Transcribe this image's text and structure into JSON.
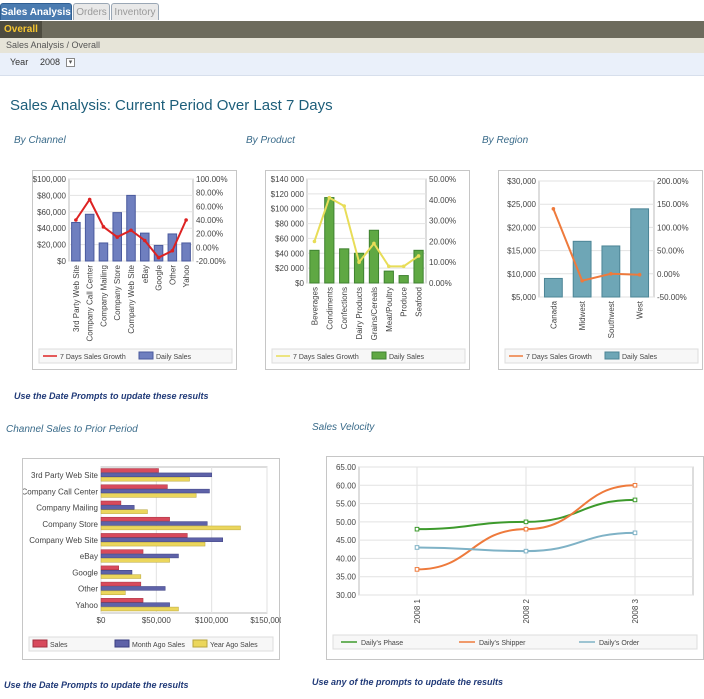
{
  "tabs": [
    {
      "label": "Sales Analysis",
      "active": true
    },
    {
      "label": "Orders",
      "active": false
    },
    {
      "label": "Inventory",
      "active": false
    }
  ],
  "subtab": "Overall",
  "breadcrumb": "Sales Analysis / Overall",
  "prompt": {
    "label": "Year",
    "value": "2008"
  },
  "page_title": "Sales Analysis: Current Period Over Last 7 Days",
  "sections": {
    "by_channel": "By Channel",
    "by_product": "By Product",
    "by_region": "By Region",
    "prior_period": "Channel Sales to Prior Period",
    "velocity": "Sales Velocity"
  },
  "notes": {
    "top": "Use the Date Prompts to update these results",
    "bottom_left": "Use the Date Prompts to update the results",
    "bottom_right": "Use any of the prompts to update the results"
  },
  "colors": {
    "accent": "#4a7bb0",
    "bar_blue": "#6f7fbf",
    "bar_green": "#5fa843",
    "bar_teal": "#6ea6b6",
    "line_red": "#dd2222",
    "line_yellow": "#e8dd58",
    "line_orange": "#ee7a3c",
    "hbar_red": "#d84a5c",
    "hbar_blue": "#5e62a8",
    "hbar_yellow": "#ebd65c"
  },
  "chart_data": [
    {
      "type": "bar",
      "id": "by_channel",
      "categories": [
        "3rd Party Web Site",
        "Company Call Center",
        "Company Mailing",
        "Company Store",
        "Company Web Site",
        "eBay",
        "Google",
        "Other",
        "Yahoo"
      ],
      "series": [
        {
          "name": "Daily Sales",
          "kind": "bar",
          "axis": "left",
          "values": [
            47000,
            57000,
            22000,
            59000,
            80000,
            34000,
            19000,
            33000,
            22000
          ]
        },
        {
          "name": "7 Days Sales Growth",
          "kind": "line",
          "axis": "right",
          "values": [
            40,
            70,
            30,
            15,
            25,
            10,
            -15,
            -5,
            40
          ]
        }
      ],
      "ylim": [
        0,
        100000
      ],
      "y2lim": [
        -20,
        100
      ],
      "yticks": [
        "$0",
        "$20,000",
        "$40,000",
        "$60,000",
        "$80,000",
        "$100,000"
      ],
      "y2ticks": [
        "-20.00%",
        "0.00%",
        "20.00%",
        "40.00%",
        "60.00%",
        "80.00%",
        "100.00%"
      ]
    },
    {
      "type": "bar",
      "id": "by_product",
      "categories": [
        "Beverages",
        "Condiments",
        "Confections",
        "Dairy Products",
        "Grains/Cereals",
        "Meat/Poultry",
        "Produce",
        "Seafood"
      ],
      "series": [
        {
          "name": "Daily Sales",
          "kind": "bar",
          "axis": "left",
          "values": [
            44000,
            115000,
            46000,
            40000,
            71000,
            16000,
            10000,
            44000
          ]
        },
        {
          "name": "7 Days Sales Growth",
          "kind": "line",
          "axis": "right",
          "values": [
            20,
            41,
            37,
            10,
            19,
            8,
            8,
            13
          ]
        }
      ],
      "ylim": [
        0,
        140000
      ],
      "y2lim": [
        0,
        50
      ],
      "yticks": [
        "$0",
        "$20 000",
        "$40 000",
        "$60 000",
        "$80 000",
        "$100 000",
        "$120 000",
        "$140 000"
      ],
      "y2ticks": [
        "0.00%",
        "10.00%",
        "20.00%",
        "30.00%",
        "40.00%",
        "50.00%"
      ]
    },
    {
      "type": "bar",
      "id": "by_region",
      "categories": [
        "Canada",
        "Midwest",
        "Southwest",
        "West"
      ],
      "series": [
        {
          "name": "Daily Sales",
          "kind": "bar",
          "axis": "left",
          "values": [
            9000,
            17000,
            16000,
            24000
          ]
        },
        {
          "name": "7 Days Sales Growth",
          "kind": "line",
          "axis": "right",
          "values": [
            140,
            -15,
            0,
            -2
          ]
        }
      ],
      "ylim": [
        5000,
        30000
      ],
      "y2lim": [
        -50,
        200
      ],
      "yticks": [
        "$5,000",
        "$10,000",
        "$15,000",
        "$20,000",
        "$25,000",
        "$30,000"
      ],
      "y2ticks": [
        "-50.00%",
        "0.00%",
        "50.00%",
        "100.00%",
        "150.00%",
        "200.00%"
      ]
    },
    {
      "type": "bar",
      "id": "prior_period",
      "orientation": "horizontal",
      "categories": [
        "3rd Party Web Site",
        "Company Call Center",
        "Company Mailing",
        "Company Store",
        "Company Web Site",
        "eBay",
        "Google",
        "Other",
        "Yahoo"
      ],
      "series": [
        {
          "name": "Sales",
          "values": [
            52000,
            60000,
            18000,
            62000,
            78000,
            38000,
            16000,
            36000,
            38000
          ]
        },
        {
          "name": "Month Ago Sales",
          "values": [
            100000,
            98000,
            30000,
            96000,
            110000,
            70000,
            28000,
            58000,
            62000
          ]
        },
        {
          "name": "Year Ago Sales",
          "values": [
            80000,
            86000,
            42000,
            126000,
            94000,
            62000,
            36000,
            22000,
            70000
          ]
        }
      ],
      "xlim": [
        0,
        150000
      ],
      "xticks": [
        "$0",
        "$50,000",
        "$100,000",
        "$150,000"
      ]
    },
    {
      "type": "line",
      "id": "velocity",
      "categories": [
        "2008 1",
        "2008 2",
        "2008 3"
      ],
      "series": [
        {
          "name": "Daily's Phase",
          "values": [
            48,
            50,
            56
          ]
        },
        {
          "name": "Daily's Shipper",
          "values": [
            37,
            48,
            60
          ]
        },
        {
          "name": "Daily's Order",
          "values": [
            43,
            42,
            47
          ]
        }
      ],
      "ylim": [
        30,
        65
      ],
      "yticks": [
        "30.00",
        "35.00",
        "40.00",
        "45.00",
        "50.00",
        "55.00",
        "60.00",
        "65.00"
      ]
    }
  ]
}
